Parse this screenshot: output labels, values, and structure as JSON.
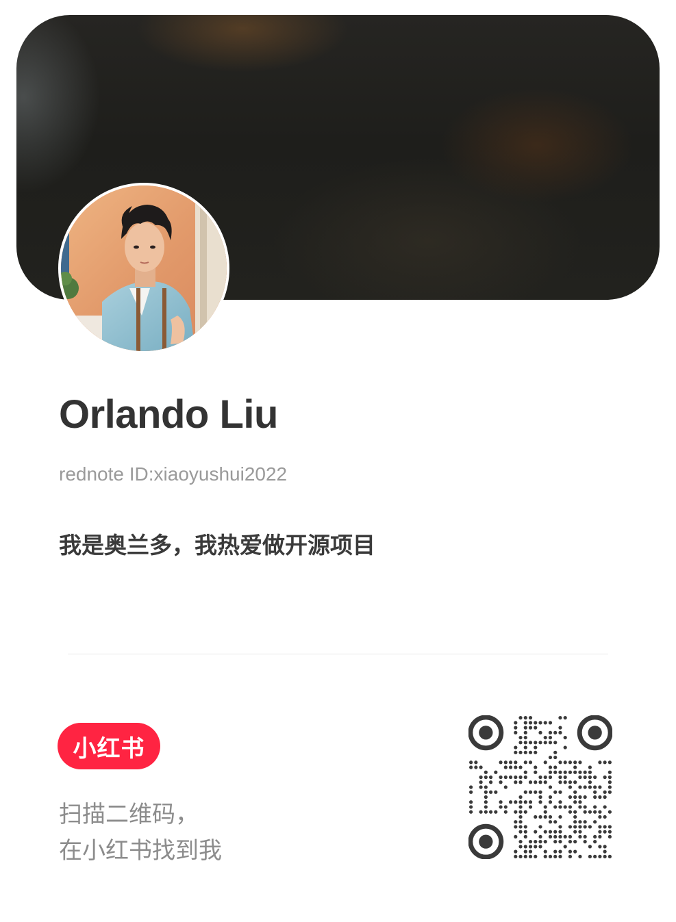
{
  "profile": {
    "name": "Orlando Liu",
    "rednote_id": "rednote ID:xiaoyushui2022",
    "bio": "我是奥兰多，我热爱做开源项目"
  },
  "brand": {
    "logo_text": "小红书",
    "color": "#ff2442"
  },
  "scan": {
    "line1": "扫描二维码，",
    "line2": "在小红书找到我"
  },
  "colors": {
    "name_text": "#333333",
    "id_text": "#9a9a9a",
    "divider": "#e6e6e6"
  }
}
